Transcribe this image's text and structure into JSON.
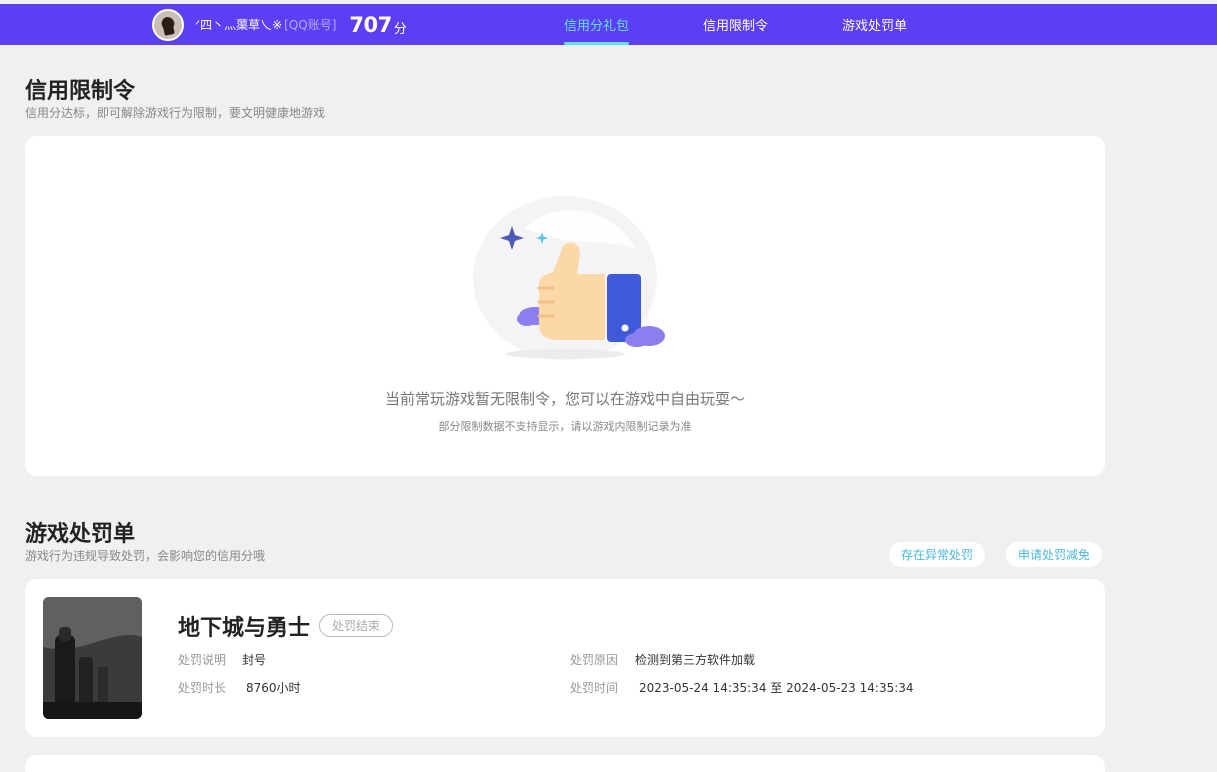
{
  "header": {
    "nickname": "ᐟ四丶灬蕖草乀※",
    "account_type": "[QQ账号]",
    "score": "707",
    "score_unit": "分",
    "nav": [
      {
        "label": "信用分礼包",
        "active": true
      },
      {
        "label": "信用限制令",
        "active": false
      },
      {
        "label": "游戏处罚单",
        "active": false
      }
    ]
  },
  "restriction": {
    "title": "信用限制令",
    "subtitle": "信用分达标，即可解除游戏行为限制，要文明健康地游戏",
    "empty_main": "当前常玩游戏暂无限制令，您可以在游戏中自由玩耍～",
    "empty_sub": "部分限制数据不支持显示，请以游戏内限制记录为准"
  },
  "penalty": {
    "title": "游戏处罚单",
    "subtitle": "游戏行为违规导致处罚，会影响您的信用分哦",
    "buttons": {
      "abnormal": "存在异常处罚",
      "appeal": "申请处罚减免"
    },
    "items": [
      {
        "game": "地下城与勇士",
        "status": "处罚结束",
        "desc_label": "处罚说明",
        "desc_value": "封号",
        "duration_label": "处罚时长",
        "duration_value": "8760小时",
        "reason_label": "处罚原因",
        "reason_value": "检测到第三方软件加载",
        "time_label": "处罚时间",
        "time_value": "2023-05-24 14:35:34 至 2024-05-23 14:35:34"
      }
    ]
  },
  "colors": {
    "topbar": "#5b3ff2",
    "nav_active": "#62e2f2",
    "link": "#4ab8e0"
  }
}
